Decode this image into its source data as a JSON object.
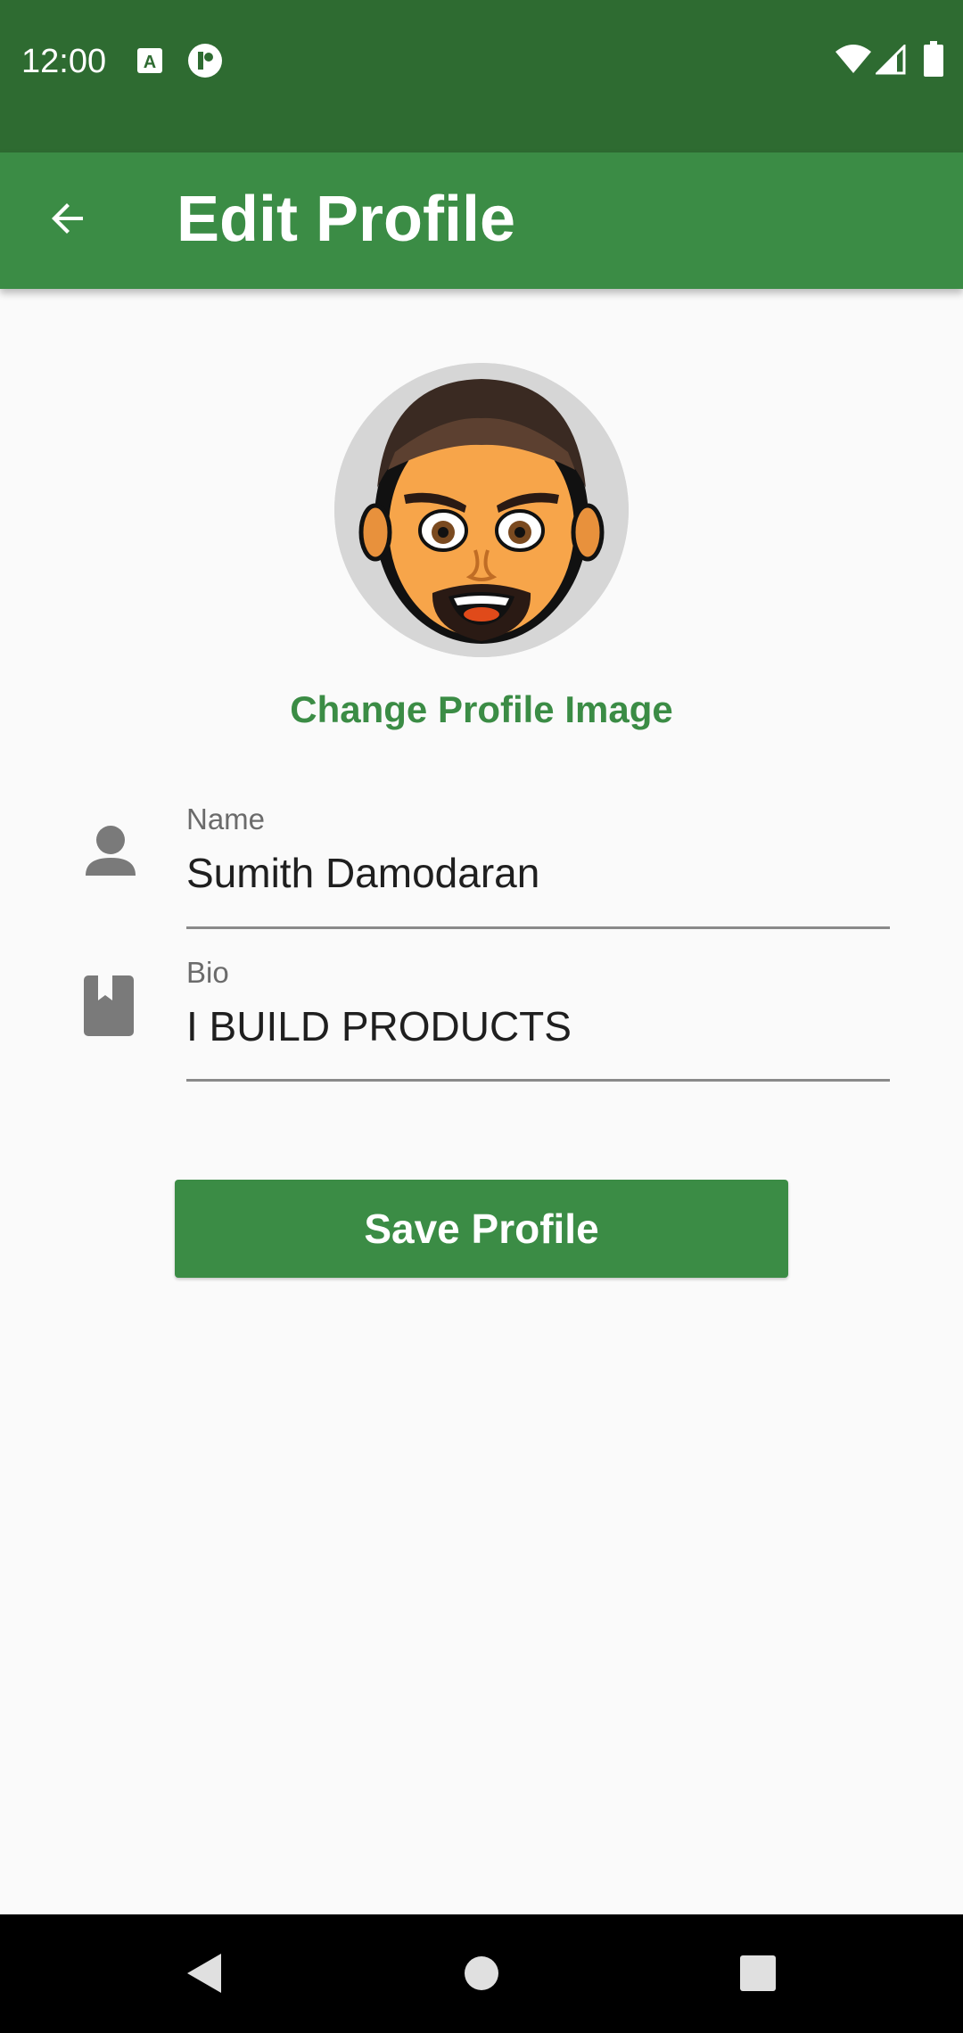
{
  "status_bar": {
    "time": "12:00",
    "icons": [
      "notification-a-icon",
      "notification-p-icon",
      "wifi-icon",
      "signal-icon",
      "battery-icon"
    ]
  },
  "app_bar": {
    "title": "Edit Profile",
    "back_icon": "arrow-back-icon"
  },
  "profile": {
    "change_image_label": "Change Profile Image"
  },
  "fields": {
    "name": {
      "label": "Name",
      "value": "Sumith Damodaran",
      "icon": "person-icon"
    },
    "bio": {
      "label": "Bio",
      "value": "I BUILD PRODUCTS",
      "icon": "book-icon"
    }
  },
  "actions": {
    "save_label": "Save Profile"
  },
  "nav_bar": {
    "icons": [
      "back-triangle-icon",
      "home-circle-icon",
      "recents-square-icon"
    ]
  },
  "colors": {
    "status_bar": "#2e6b31",
    "primary": "#3b8c45",
    "background": "#fafafa"
  }
}
